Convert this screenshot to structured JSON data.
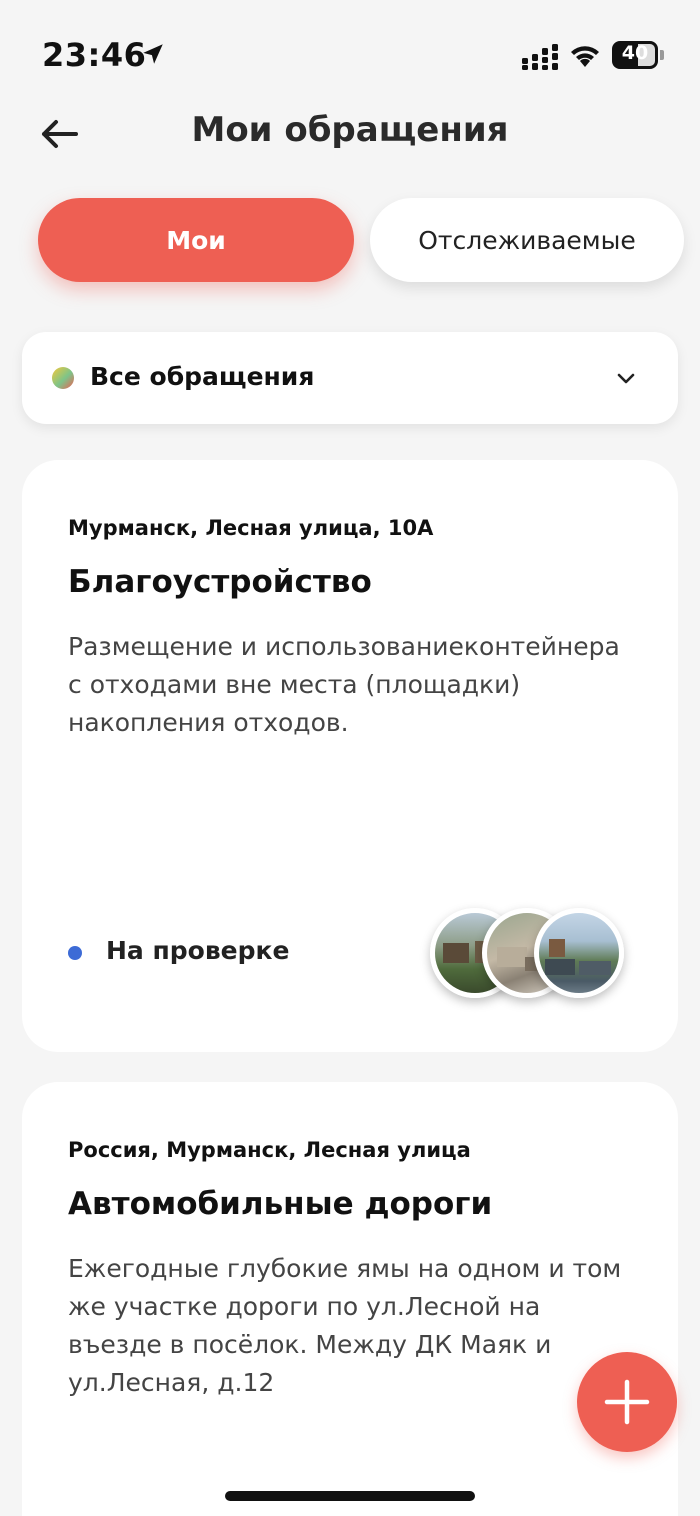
{
  "status_bar": {
    "time": "23:46",
    "battery": "40",
    "icons": [
      "location-arrow-icon",
      "signal-icon",
      "wifi-icon",
      "battery-icon"
    ]
  },
  "header": {
    "title": "Мои обращения",
    "back_icon": "arrow-left-icon"
  },
  "tabs": [
    {
      "label": "Мои",
      "active": true
    },
    {
      "label": "Отслеживаемые",
      "active": false
    }
  ],
  "filter": {
    "label": "Все обращения",
    "icon": "chevron-down-icon"
  },
  "appeals": [
    {
      "address": "Мурманск, Лесная улица, 10А",
      "category": "Благоустройство",
      "description": "Размещение и использованиеконтейнера с отходами вне места (площадки) накопления отходов.",
      "status": "На проверке",
      "status_color": "#3d6bd6",
      "photo_count": 3
    },
    {
      "address": "Россия, Мурманск, Лесная улица",
      "category": "Автомобильные дороги",
      "description": "Ежегодные глубокие ямы на одном и том же участке дороги по ул.Лесной на въезде в посёлок. Между ДК Маяк и ул.Лесная, д.12"
    }
  ],
  "fab": {
    "icon": "plus-icon"
  },
  "colors": {
    "accent": "#ee5f53",
    "background": "#f5f5f5",
    "card": "#ffffff"
  }
}
